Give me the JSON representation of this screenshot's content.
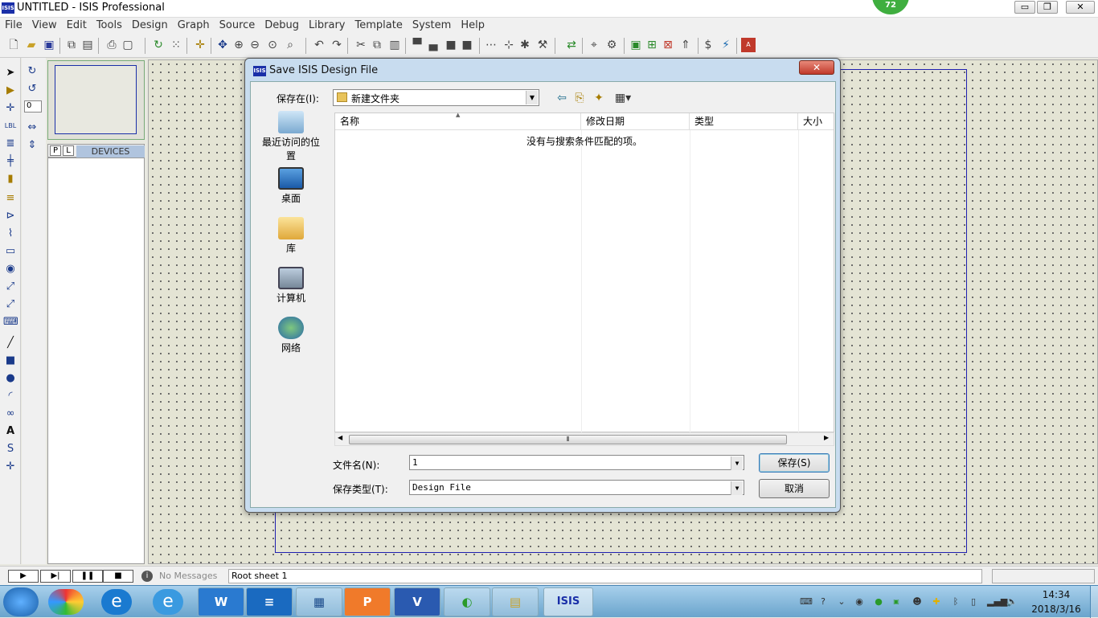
{
  "window": {
    "title": "UNTITLED - ISIS Professional",
    "app_icon": "ISIS",
    "badge": "72",
    "minimize": "▭",
    "restore": "❐",
    "close": "✕"
  },
  "menu": [
    "File",
    "View",
    "Edit",
    "Tools",
    "Design",
    "Graph",
    "Source",
    "Debug",
    "Library",
    "Template",
    "System",
    "Help"
  ],
  "left_panel": {
    "tab_p": "P",
    "tab_l": "L",
    "title": "DEVICES",
    "rotation_value": "0"
  },
  "dialog": {
    "title": "Save ISIS Design File",
    "icon": "ISIS",
    "close": "✕",
    "save_in_label": "保存在(I):",
    "save_in_value": "新建文件夹",
    "places": [
      "最近访问的位置",
      "桌面",
      "库",
      "计算机",
      "网络"
    ],
    "columns": [
      "名称",
      "修改日期",
      "类型",
      "大小"
    ],
    "empty_message": "没有与搜索条件匹配的项。",
    "filename_label": "文件名(N):",
    "filename_value": "1",
    "filetype_label": "保存类型(T):",
    "filetype_value": "Design File",
    "save_button": "保存(S)",
    "cancel_button": "取消"
  },
  "status": {
    "messages": "No Messages",
    "sheet": "Root sheet 1"
  },
  "taskbar": {
    "apps": [
      "W",
      "≡",
      "▦",
      "P",
      "V",
      "◐",
      "▤",
      "ISIS"
    ],
    "time": "14:34",
    "date": "2018/3/16"
  },
  "colors": {
    "accent": "#1a2fa8",
    "canvas": "#e4e4d4",
    "sheet_border": "#2020b0",
    "dialog_frame": "#c8dcef",
    "close_red": "#c0392b"
  }
}
